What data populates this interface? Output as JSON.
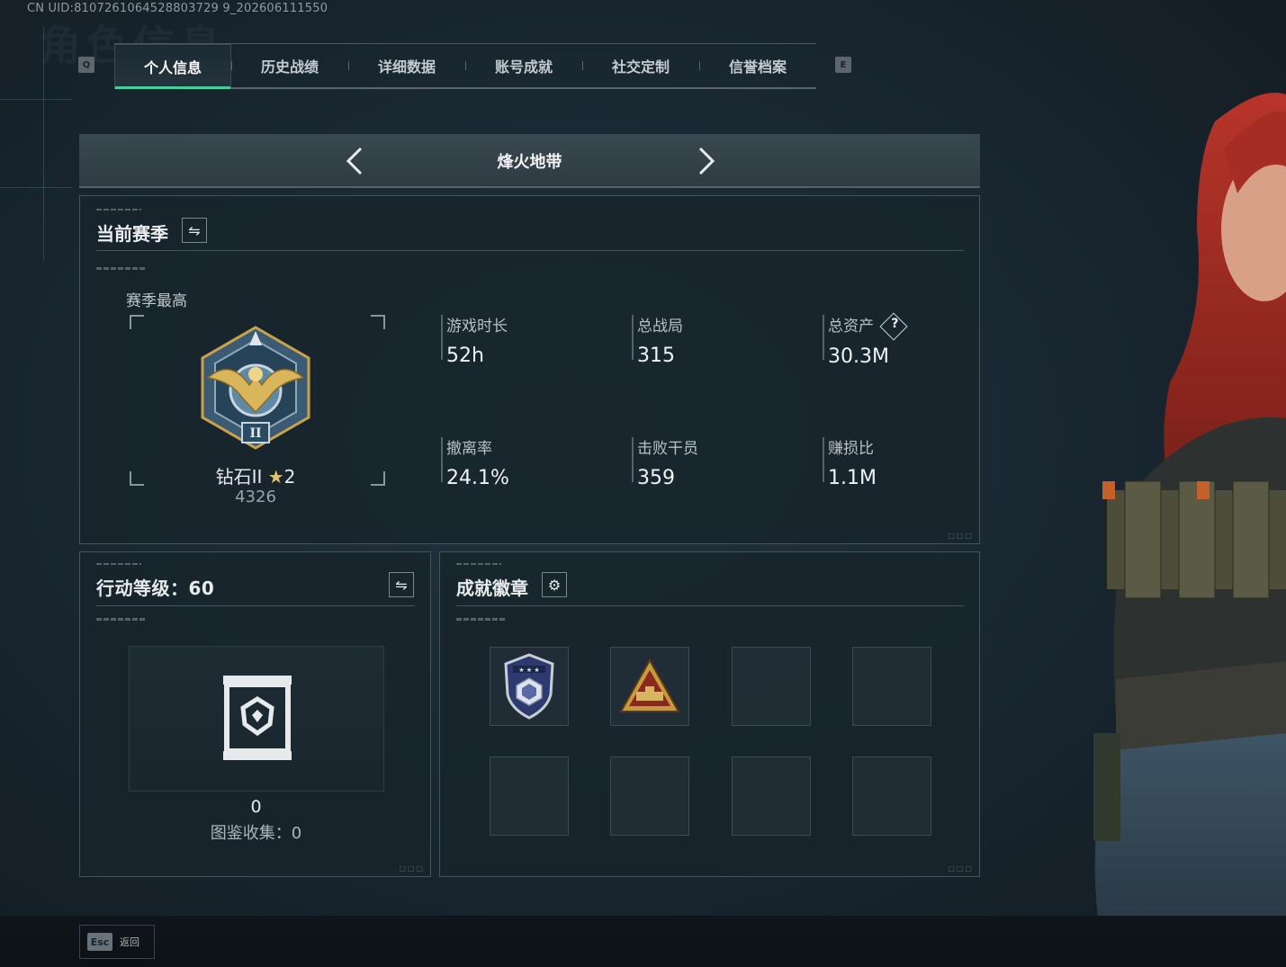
{
  "uid_text": "CN UID:8107261064528803729 9_202606111550",
  "tabs": {
    "left_key": "Q",
    "right_key": "E",
    "items": [
      {
        "label": "个人信息"
      },
      {
        "label": "历史战绩"
      },
      {
        "label": "详细数据"
      },
      {
        "label": "账号成就"
      },
      {
        "label": "社交定制"
      },
      {
        "label": "信誉档案"
      }
    ],
    "active_index": 0,
    "accent_color": "#3fd09b"
  },
  "mode_selector": {
    "title": "烽火地带",
    "prev_icon": "chevron-left-icon",
    "next_icon": "chevron-right-icon"
  },
  "season_panel": {
    "title": "当前赛季",
    "switch_icon": "swap-icon",
    "best_label": "赛季最高",
    "rank_name": "钻石II",
    "rank_stars": "2",
    "rank_points": "4326",
    "stats": [
      {
        "label": "游戏时长",
        "value": "52h"
      },
      {
        "label": "总战局",
        "value": "315"
      },
      {
        "label": "总资产",
        "value": "30.3M",
        "help": "?"
      },
      {
        "label": "撤离率",
        "value": "24.1%"
      },
      {
        "label": "击败干员",
        "value": "359"
      },
      {
        "label": "赚损比",
        "value": "1.1M"
      }
    ]
  },
  "level_panel": {
    "title": "行动等级：60",
    "switch_icon": "swap-icon",
    "collection_count": "0",
    "collection_label": "图鉴收集：0"
  },
  "badges_panel": {
    "title": "成就徽章",
    "settings_icon": "gear-icon",
    "slots_filled": 2,
    "slots_total": 8
  },
  "footer": {
    "esc_key": "Esc",
    "back_label": "返回"
  }
}
